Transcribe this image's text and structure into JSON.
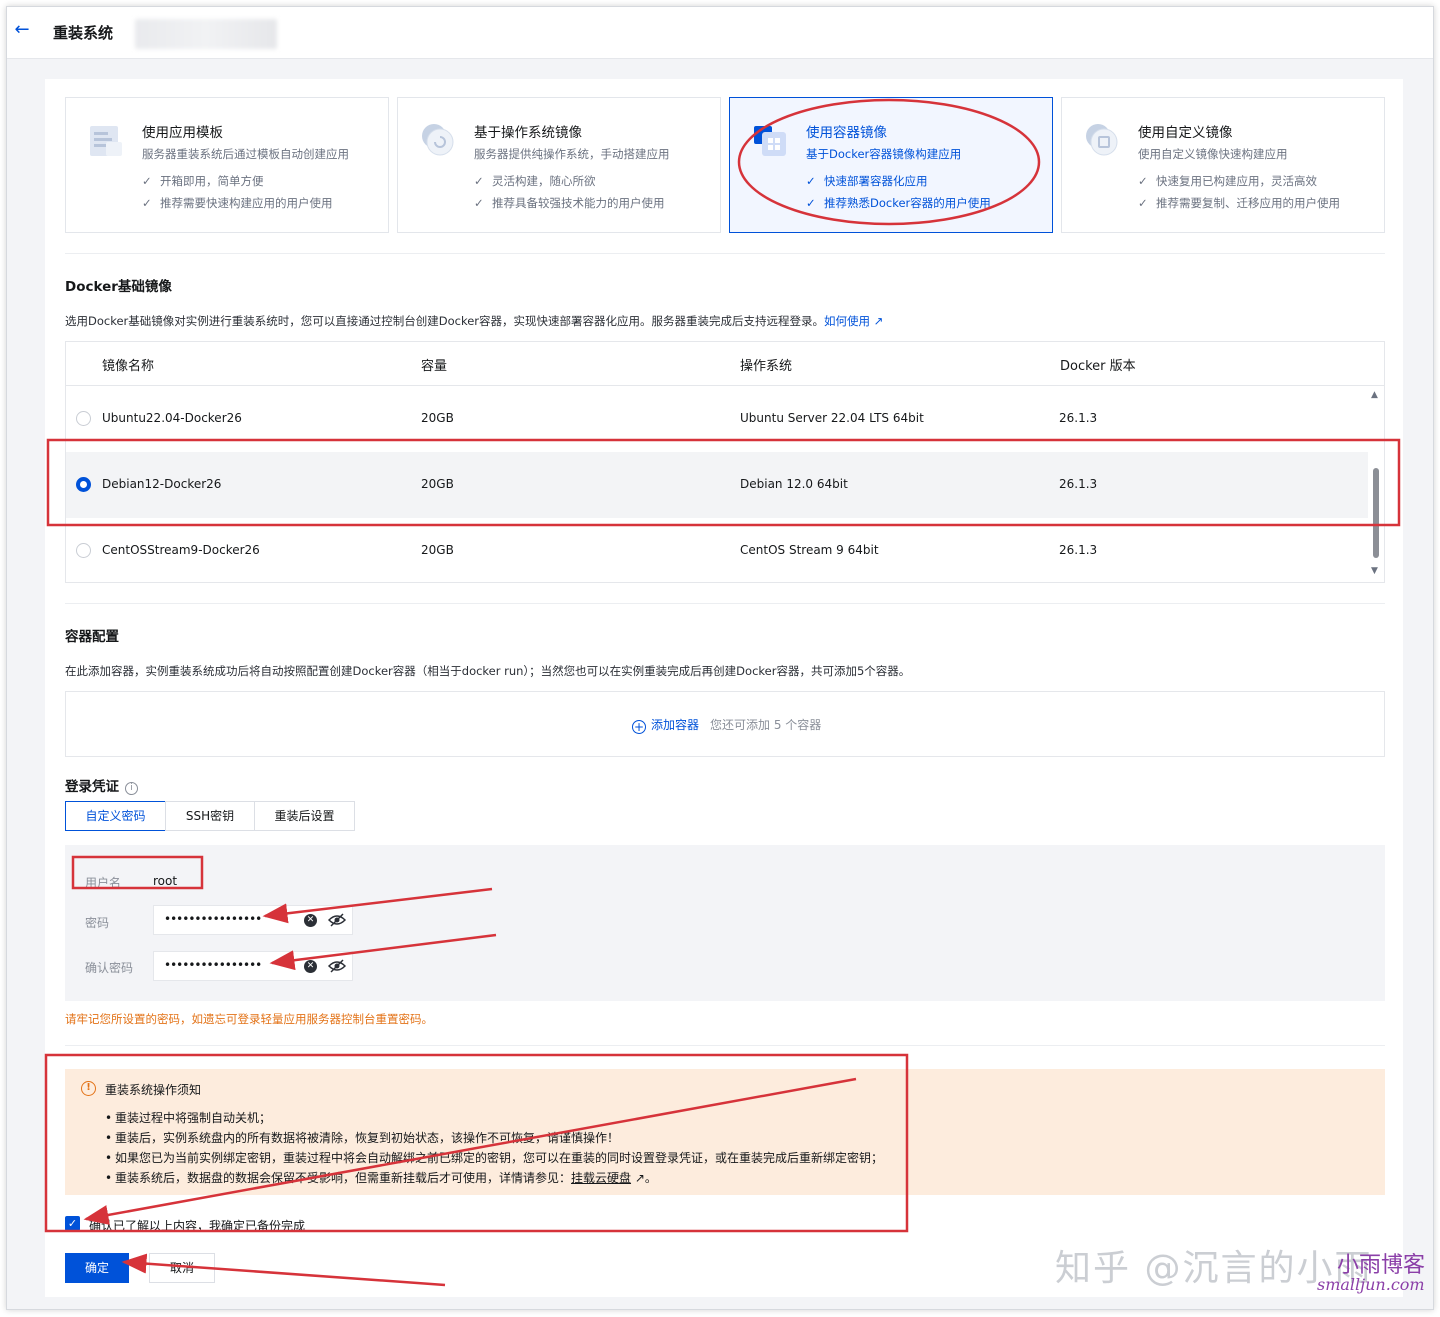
{
  "header": {
    "title": "重装系统"
  },
  "types": [
    {
      "title": "使用应用模板",
      "desc": "服务器重装系统后通过模板自动创建应用",
      "checks": [
        "开箱即用，简单方便",
        "推荐需要快速构建应用的用户使用"
      ],
      "icon": "template-icon"
    },
    {
      "title": "基于操作系统镜像",
      "desc": "服务器提供纯操作系统，手动搭建应用",
      "checks": [
        "灵活构建，随心所欲",
        "推荐具备较强技术能力的用户使用"
      ],
      "icon": "os-image-icon"
    },
    {
      "title": "使用容器镜像",
      "desc": "基于Docker容器镜像构建应用",
      "checks": [
        "快速部署容器化应用",
        "推荐熟悉Docker容器的用户使用"
      ],
      "icon": "container-image-icon"
    },
    {
      "title": "使用自定义镜像",
      "desc": "使用自定义镜像快速构建应用",
      "checks": [
        "快速复用已构建应用，灵活高效",
        "推荐需要复制、迁移应用的用户使用"
      ],
      "icon": "custom-image-icon"
    }
  ],
  "selected_type": 2,
  "docker": {
    "heading": "Docker基础镜像",
    "desc": "选用Docker基础镜像对实例进行重装系统时，您可以直接通过控制台创建Docker容器，实现快速部署容器化应用。服务器重装完成后支持远程登录。",
    "help_link": "如何使用",
    "columns": [
      "镜像名称",
      "容量",
      "操作系统",
      "Docker 版本"
    ],
    "rows": [
      {
        "name": "Ubuntu22.04-Docker26",
        "size": "20GB",
        "os": "Ubuntu Server 22.04 LTS 64bit",
        "version": "26.1.3"
      },
      {
        "name": "Debian12-Docker26",
        "size": "20GB",
        "os": "Debian 12.0 64bit",
        "version": "26.1.3"
      },
      {
        "name": "CentOSStream9-Docker26",
        "size": "20GB",
        "os": "CentOS Stream 9 64bit",
        "version": "26.1.3"
      }
    ],
    "selected_row": 1
  },
  "container": {
    "heading": "容器配置",
    "desc": "在此添加容器，实例重装系统成功后将自动按照配置创建Docker容器（相当于docker run）；当然您也可以在实例重装完成后再创建Docker容器，共可添加5个容器。",
    "add_label": "添加容器",
    "add_hint": "您还可添加 5 个容器"
  },
  "login": {
    "heading": "登录凭证",
    "tabs": [
      "自定义密码",
      "SSH密钥",
      "重装后设置"
    ],
    "active_tab": 0,
    "username_label": "用户名",
    "username": "root",
    "password_label": "密码",
    "password_mask": "••••••••••••••••",
    "confirm_label": "确认密码",
    "confirm_mask": "••••••••••••••••",
    "warning": "请牢记您所设置的密码，如遗忘可登录轻量应用服务器控制台重置密码。"
  },
  "notice": {
    "title": "重装系统操作须知",
    "items": [
      "重装过程中将强制自动关机；",
      "重装后，实例系统盘内的所有数据将被清除，恢复到初始状态，该操作不可恢复，请谨慎操作！",
      "如果您已为当前实例绑定密钥，重装过程中将会自动解绑之前已绑定的密钥，您可以在重装的同时设置登录凭证，或在重装完成后重新绑定密钥；"
    ],
    "last_item_prefix": "重装系统后，数据盘的数据会保留不受影响，但需重新挂载后才可使用，详情请参见：",
    "last_item_link": "挂载云硬盘",
    "last_item_suffix": "。"
  },
  "agree": {
    "label": "确认已了解以上内容，我确定已备份完成",
    "checked": true
  },
  "actions": {
    "ok": "确定",
    "cancel": "取消"
  },
  "watermark": {
    "text": "知乎 @沉言的小雨",
    "brand": "小雨博客",
    "site": "smalljun.com"
  },
  "colors": {
    "primary": "#0052d9",
    "warning": "#e37318",
    "annotation": "#d6333a",
    "notice_bg": "#fdecdd"
  }
}
